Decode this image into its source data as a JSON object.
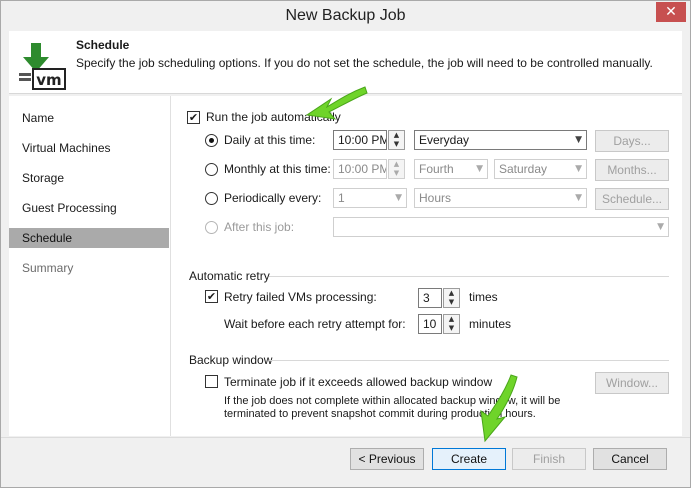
{
  "window": {
    "title": "New Backup Job",
    "close_glyph": "✕"
  },
  "header": {
    "icon": "vm-download-icon",
    "icon_text": "vm",
    "title": "Schedule",
    "description": "Specify the job scheduling options. If you do not set the schedule, the job will need to be controlled manually."
  },
  "sidebar": {
    "items": [
      {
        "label": "Name"
      },
      {
        "label": "Virtual Machines"
      },
      {
        "label": "Storage"
      },
      {
        "label": "Guest Processing"
      },
      {
        "label": "Schedule",
        "active": true
      },
      {
        "label": "Summary",
        "dim": true
      }
    ]
  },
  "schedule": {
    "run_auto_label": "Run the job automatically",
    "run_auto_checked": true,
    "daily_label": "Daily at this time:",
    "daily_time": "10:00 PM",
    "daily_recurrence": "Everyday",
    "days_button": "Days...",
    "monthly_label": "Monthly at this time:",
    "monthly_time": "10:00 PM",
    "monthly_week": "Fourth",
    "monthly_day": "Saturday",
    "months_button": "Months...",
    "periodic_label": "Periodically every:",
    "periodic_value": "1",
    "periodic_unit": "Hours",
    "schedule_button": "Schedule...",
    "after_label": "After this job:",
    "after_value": ""
  },
  "retry": {
    "section_title": "Automatic retry",
    "retry_label": "Retry failed VMs processing:",
    "retry_checked": true,
    "retry_count": "3",
    "retry_unit": "times",
    "wait_label": "Wait before each retry attempt for:",
    "wait_value": "10",
    "wait_unit": "minutes"
  },
  "backup_window": {
    "section_title": "Backup window",
    "terminate_label": "Terminate job if it exceeds allowed backup window",
    "terminate_checked": false,
    "window_button": "Window...",
    "note_line1": "If the job does not complete within allocated backup window, it will be",
    "note_line2": "terminated to prevent snapshot commit during production hours."
  },
  "footer": {
    "previous": "< Previous",
    "create": "Create",
    "finish": "Finish",
    "cancel": "Cancel"
  },
  "colors": {
    "annotation_arrow": "#6fd42a",
    "active_nav": "#aaaaaa",
    "close_button": "#c75050"
  }
}
